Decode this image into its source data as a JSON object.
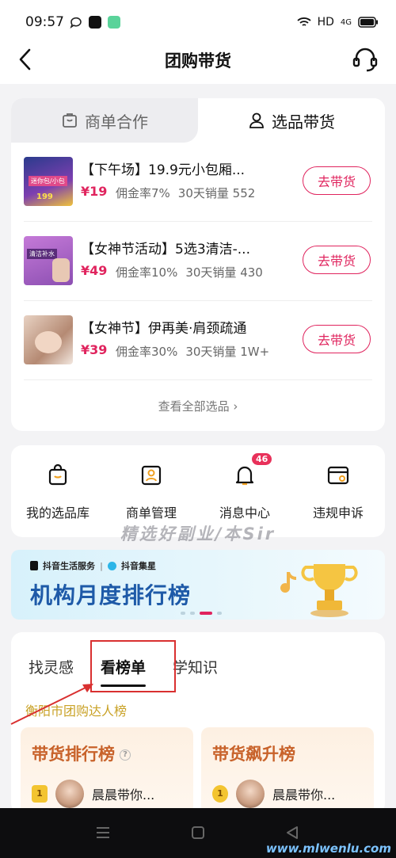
{
  "status_bar": {
    "time": "09:57",
    "network": "HD",
    "signal": "4G"
  },
  "header": {
    "title": "团购带货"
  },
  "top_tabs": [
    {
      "label": "商单合作",
      "active": false
    },
    {
      "label": "选品带货",
      "active": true
    }
  ],
  "products": [
    {
      "name": "【下午场】19.9元小包厢...",
      "price": "¥19",
      "commission": "佣金率7%",
      "sales": "30天销量 552",
      "button": "去带货",
      "thumb_text": "迷你包/小包"
    },
    {
      "name": "【女神节活动】5选3清洁-...",
      "price": "¥49",
      "commission": "佣金率10%",
      "sales": "30天销量 430",
      "button": "去带货",
      "thumb_text": "清洁补水"
    },
    {
      "name": "【女神节】伊再美·肩颈疏通",
      "price": "¥39",
      "commission": "佣金率30%",
      "sales": "30天销量 1W+",
      "button": "去带货",
      "thumb_text": ""
    }
  ],
  "view_all": "查看全部选品 ›",
  "tools": [
    {
      "label": "我的选品库",
      "icon": "shopping-bag-icon"
    },
    {
      "label": "商单管理",
      "icon": "portrait-card-icon"
    },
    {
      "label": "消息中心",
      "icon": "bell-icon",
      "badge": "46"
    },
    {
      "label": "违规申诉",
      "icon": "appeal-card-icon"
    }
  ],
  "watermark": "精选好副业/本Sir",
  "banner": {
    "brand_left": "抖音生活服务",
    "brand_right": "抖音集星",
    "title": "机构月度排行榜"
  },
  "rank_tabs": [
    {
      "label": "找灵感",
      "active": false
    },
    {
      "label": "看榜单",
      "active": true
    },
    {
      "label": "学知识",
      "active": false
    }
  ],
  "city_label": "衡阳市团购达人榜",
  "rank_cards": [
    {
      "title": "带货排行榜",
      "medal": "1",
      "user": "晨晨带你..."
    },
    {
      "title": "带货飙升榜",
      "medal": "1",
      "user": "晨晨带你..."
    }
  ],
  "site_mark": "www.mlwenlu.com",
  "colors": {
    "accent": "#e0245e",
    "banner_title": "#1e5aa8",
    "rank_title": "#c8622a",
    "city_label": "#c9a227"
  }
}
